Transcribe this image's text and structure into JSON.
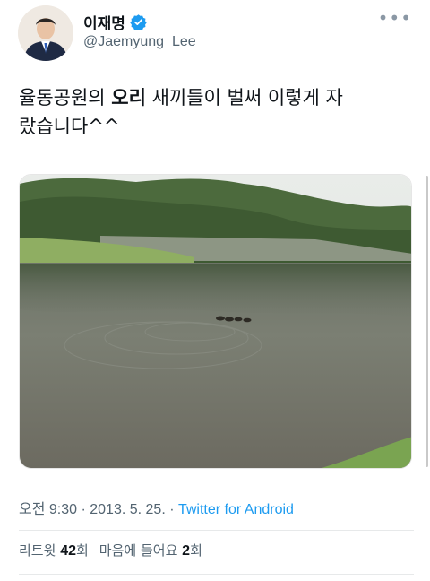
{
  "author": {
    "name": "이재명",
    "handle": "@Jaemyung_Lee",
    "verified": true
  },
  "tweet": {
    "text_line1_before": "율동공원의 ",
    "text_bold": "오리",
    "text_line1_after": " 새끼들이 벌써 이렇게 자",
    "text_line2": "랐습니다^^"
  },
  "meta": {
    "time": "오전 9:30",
    "sep1": " · ",
    "date": "2013. 5. 25.",
    "sep2": " · ",
    "source": "Twitter for Android"
  },
  "stats": {
    "retweet_label": "리트윗",
    "retweet_count": "42",
    "retweet_unit": "회",
    "like_label": "마음에 들어요",
    "like_count": "2",
    "like_unit": "회"
  },
  "icons": {
    "verified": "verified-badge-icon",
    "more": "more-icon"
  },
  "colors": {
    "link": "#1d9bf0",
    "muted": "#536471",
    "text": "#0f1419"
  }
}
